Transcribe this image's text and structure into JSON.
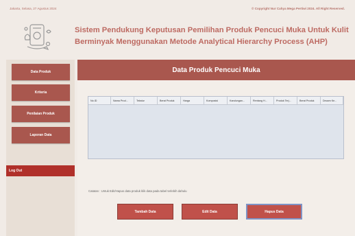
{
  "header": {
    "date": "Jakarta, Selasa, 27 Agustus 2024",
    "copyright": "© Copyright Nur Cahya Mega Pertiwi 2024. All Right Reserved.",
    "app_title": "Sistem Pendukung Keputusan Pemilihan Produk Pencuci Muka Untuk Kulit Berminyak Menggunakan Metode Analytical Hierarchy Process (AHP)"
  },
  "sidebar": {
    "items": [
      {
        "label": "Data Produk"
      },
      {
        "label": "Kriteria"
      },
      {
        "label": "Penilaian Produk"
      },
      {
        "label": "Laporan Data"
      }
    ],
    "logout": "Log Out"
  },
  "main": {
    "page_title": "Data Produk Pencuci Muka",
    "table": {
      "columns": [
        "No.ID",
        "Nama Prod...",
        "Tekstur",
        "Berat Produk",
        "Harga",
        "Komposisi",
        "Kandungan...",
        "Rentang H...",
        "Produk Terj...",
        "Berat Produk",
        "Decam Ke..."
      ]
    },
    "note": "Catatan : Untuk Edit/Hapus data produk klik data pada tabel terlebih dahulu",
    "buttons": {
      "add": "Tambah Data",
      "edit": "Edit Data",
      "delete": "Hapus Data"
    }
  }
}
